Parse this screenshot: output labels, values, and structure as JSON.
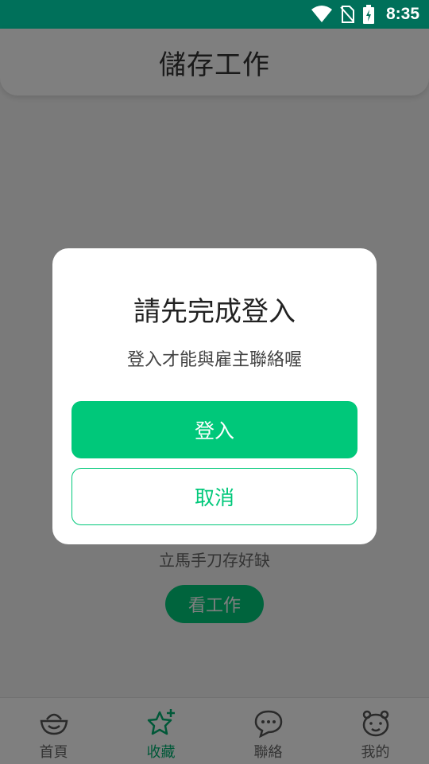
{
  "status_bar": {
    "time": "8:35",
    "icons": [
      "wifi-icon",
      "no-sim-icon",
      "battery-charging-icon"
    ]
  },
  "header": {
    "title": "儲存工作"
  },
  "empty_state": {
    "message": "立馬手刀存好缺",
    "button_label": "看工作"
  },
  "tabbar": {
    "items": [
      {
        "label": "首頁",
        "icon": "home-bowl-icon",
        "active": false
      },
      {
        "label": "收藏",
        "icon": "star-plus-icon",
        "active": true
      },
      {
        "label": "聯絡",
        "icon": "chat-bubble-icon",
        "active": false
      },
      {
        "label": "我的",
        "icon": "profile-face-icon",
        "active": false
      }
    ]
  },
  "dialog": {
    "title": "請先完成登入",
    "message": "登入才能與雇主聯絡喔",
    "confirm_label": "登入",
    "cancel_label": "取消"
  },
  "colors": {
    "status_bar": "#00705a",
    "accent": "#00c87a",
    "overlay": "rgba(0,0,0,0.5)"
  }
}
